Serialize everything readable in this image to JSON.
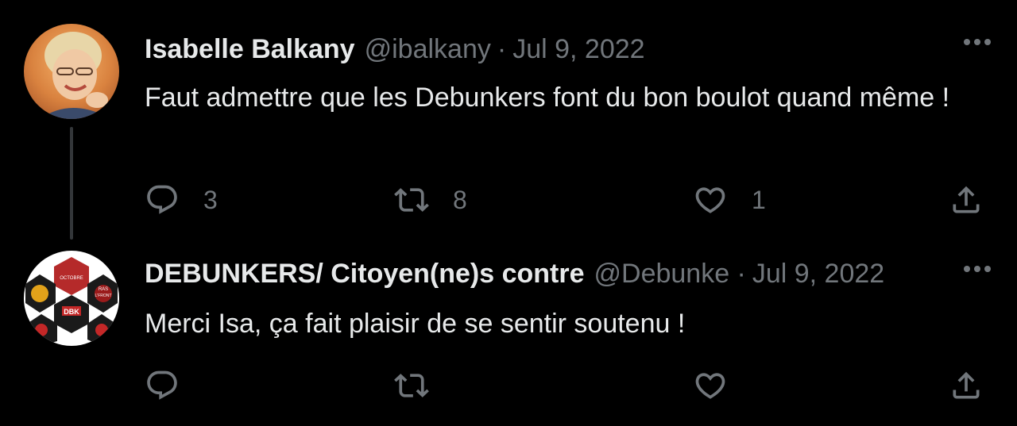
{
  "colors": {
    "background": "#000000",
    "text": "#e7e9ea",
    "secondary": "#71767b",
    "thread_line": "#333639"
  },
  "tweets": [
    {
      "display_name": "Isabelle Balkany",
      "handle": "@ibalkany",
      "separator": "·",
      "date": "Jul 9, 2022",
      "text": "Faut admettre que les Debunkers font du bon boulot quand même !",
      "reply_count": "3",
      "retweet_count": "8",
      "like_count": "1",
      "icons": [
        "avatar-photo",
        "more-icon",
        "reply-icon",
        "retweet-icon",
        "like-icon",
        "share-icon"
      ]
    },
    {
      "display_name": "DEBUNKERS/ Citoyen(ne)s contre",
      "handle": "@Debunkers",
      "separator": "·",
      "date": "Jul 9, 2022",
      "text": "Merci Isa, ça fait plaisir de se sentir soutenu !",
      "avatar_labels": [
        "DBK",
        "RAS L'FRONT",
        "OCTOBRE"
      ],
      "icons": [
        "avatar-logo-collage",
        "more-icon",
        "reply-icon",
        "retweet-icon",
        "like-icon",
        "share-icon"
      ]
    }
  ]
}
